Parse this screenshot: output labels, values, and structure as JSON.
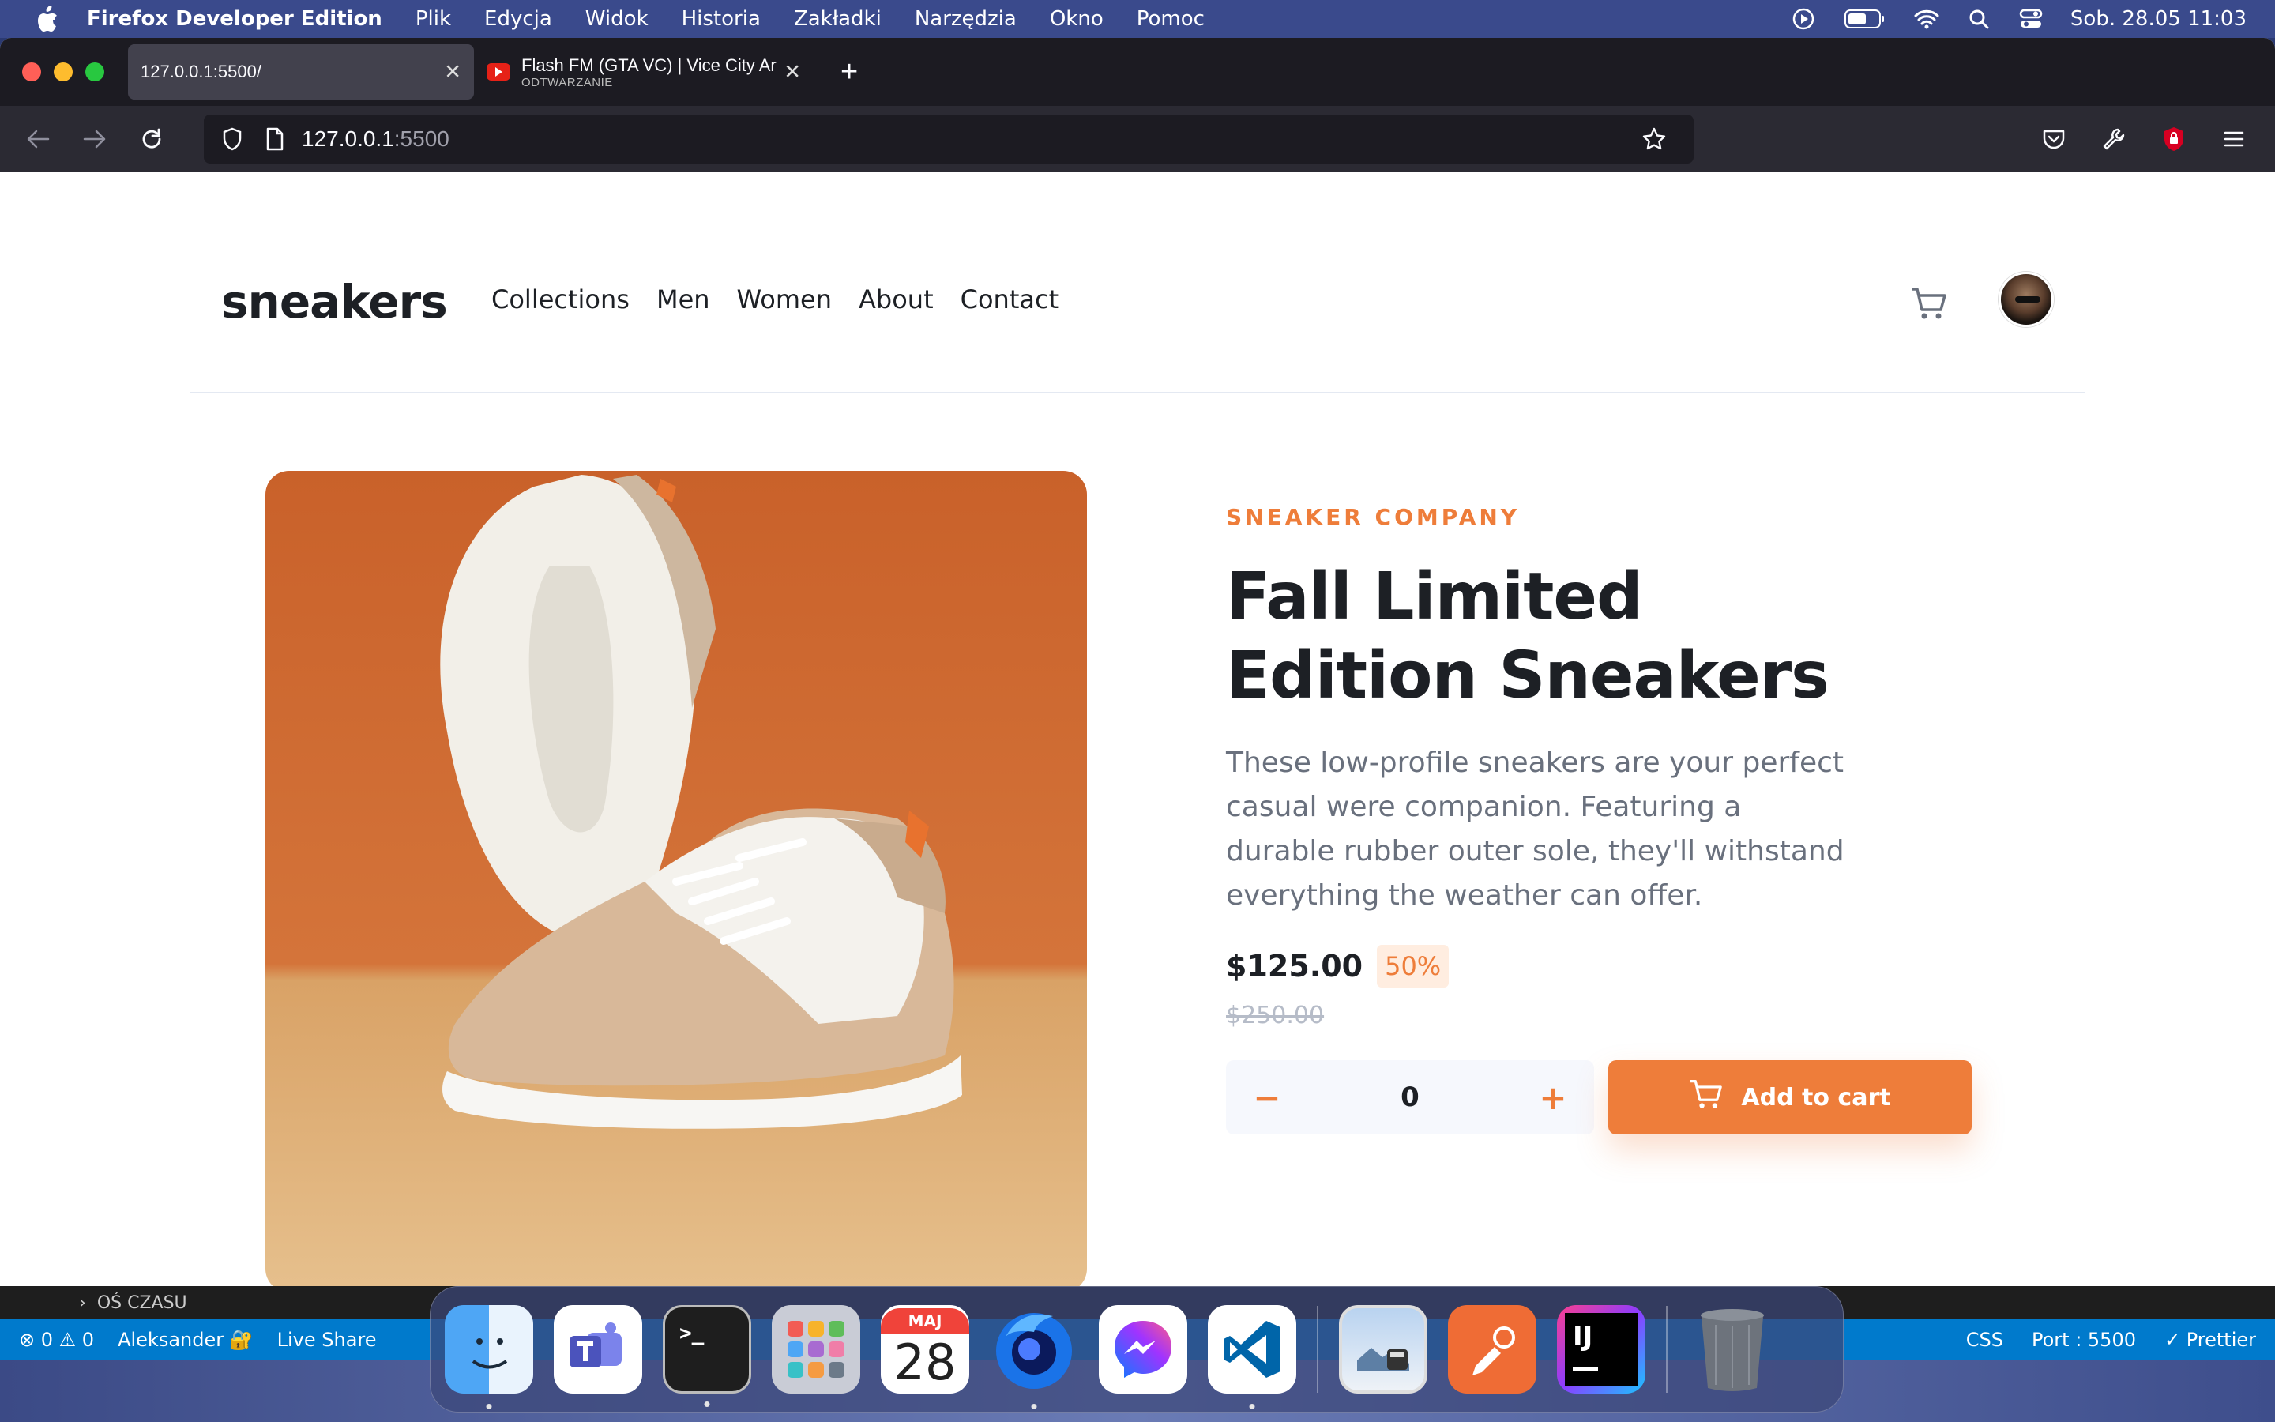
{
  "menubar": {
    "app_name": "Firefox Developer Edition",
    "items": [
      "Plik",
      "Edycja",
      "Widok",
      "Historia",
      "Zakładki",
      "Narzędzia",
      "Okno",
      "Pomoc"
    ],
    "datetime": "Sob. 28.05  11:03"
  },
  "browser": {
    "tabs": [
      {
        "title": "127.0.0.1:5500/"
      },
      {
        "title": "Flash FM (GTA VC) | Vice City Ar",
        "subtitle": "ODTWARZANIE"
      }
    ],
    "url_host": "127.0.0.1",
    "url_port": ":5500"
  },
  "site": {
    "logo": "sneakers",
    "nav": [
      "Collections",
      "Men",
      "Women",
      "About",
      "Contact"
    ]
  },
  "product": {
    "company": "SNEAKER COMPANY",
    "title": "Fall Limited Edition Sneakers",
    "description": "These low-profile sneakers are your perfect casual were companion. Featuring a durable rubber outer sole, they'll withstand everything the weather can offer.",
    "price": "$125.00",
    "discount": "50%",
    "old_price": "$250.00",
    "quantity": "0",
    "minus": "−",
    "plus": "+",
    "add_to_cart": "Add to cart"
  },
  "vscode": {
    "timeline": "OŚ CZASU",
    "status_left": [
      "⊗ 0 ⚠ 0",
      "Aleksander 🔐",
      "Live Share"
    ],
    "status_right": [
      "CSS",
      "Port : 5500",
      "✓ Prettier"
    ]
  },
  "dock": {
    "calendar_month": "MAJ",
    "calendar_day": "28",
    "terminal_prompt": ">_",
    "intellij_label": "IJ"
  },
  "colors": {
    "accent": "#ee7d3a",
    "text_dark": "#1d2025",
    "text_muted": "#69707d"
  }
}
